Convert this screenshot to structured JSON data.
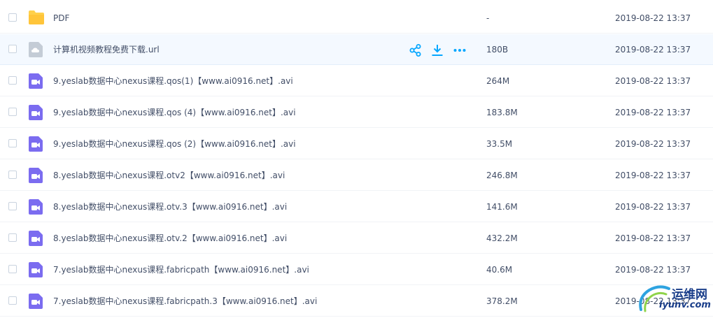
{
  "files": [
    {
      "name": "PDF",
      "size": "-",
      "date": "2019-08-22 13:37",
      "type": "folder"
    },
    {
      "name": "计算机视频教程免费下载.url",
      "size": "180B",
      "date": "2019-08-22 13:37",
      "type": "url"
    },
    {
      "name": "9.yeslab数据中心nexus课程.qos(1)【www.ai0916.net】.avi",
      "size": "264M",
      "date": "2019-08-22 13:37",
      "type": "video"
    },
    {
      "name": "9.yeslab数据中心nexus课程.qos (4)【www.ai0916.net】.avi",
      "size": "183.8M",
      "date": "2019-08-22 13:37",
      "type": "video"
    },
    {
      "name": "9.yeslab数据中心nexus课程.qos (2)【www.ai0916.net】.avi",
      "size": "33.5M",
      "date": "2019-08-22 13:37",
      "type": "video"
    },
    {
      "name": "8.yeslab数据中心nexus课程.otv2【www.ai0916.net】.avi",
      "size": "246.8M",
      "date": "2019-08-22 13:37",
      "type": "video"
    },
    {
      "name": "8.yeslab数据中心nexus课程.otv.3【www.ai0916.net】.avi",
      "size": "141.6M",
      "date": "2019-08-22 13:37",
      "type": "video"
    },
    {
      "name": "8.yeslab数据中心nexus课程.otv.2【www.ai0916.net】.avi",
      "size": "432.2M",
      "date": "2019-08-22 13:37",
      "type": "video"
    },
    {
      "name": "7.yeslab数据中心nexus课程.fabricpath【www.ai0916.net】.avi",
      "size": "40.6M",
      "date": "2019-08-22 13:37",
      "type": "video"
    },
    {
      "name": "7.yeslab数据中心nexus课程.fabricpath.3【www.ai0916.net】.avi",
      "size": "378.2M",
      "date": "2019-08-22 13:37",
      "type": "video"
    }
  ],
  "hovered_row": 1,
  "row_actions": [
    "share-icon",
    "download-icon",
    "more-icon"
  ],
  "icons": {
    "folder": "folder-icon",
    "url": "cloud-link-file-icon",
    "video": "video-file-icon"
  },
  "colors": {
    "accent": "#06a7ff",
    "folder": "#ffd04b",
    "video": "#7b6cf0",
    "url": "#c4ccd6",
    "text": "#424e67",
    "hover_bg": "#f4f9ff"
  },
  "watermark": {
    "cn": "运维网",
    "en": "iyunv.com"
  }
}
